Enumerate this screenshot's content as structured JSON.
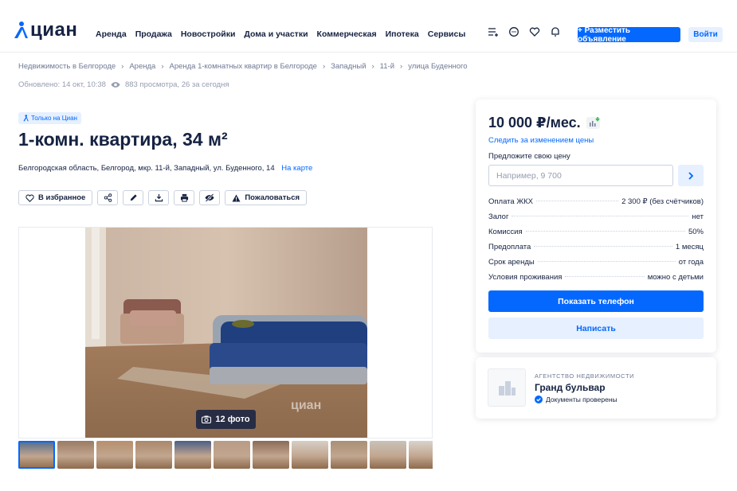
{
  "header": {
    "logo_text": "циан",
    "nav": [
      "Аренда",
      "Продажа",
      "Новостройки",
      "Дома и участки",
      "Коммерческая",
      "Ипотека",
      "Сервисы"
    ],
    "post_button": "+ Разместить объявление",
    "login_button": "Войти"
  },
  "breadcrumbs": [
    "Недвижимость в Белгороде",
    "Аренда",
    "Аренда 1-комнатных квартир в Белгороде",
    "Западный",
    "11-й",
    "улица Буденного"
  ],
  "meta": {
    "updated": "Обновлено: 14 окт, 10:38",
    "views": "883 просмотра, 26 за сегодня"
  },
  "listing": {
    "badge": "Только на Циан",
    "title": "1-комн. квартира, 34 м²",
    "address": "Белгородская область, Белгород, мкр. 11-й, Западный, ул. Буденного, 14",
    "map_link": "На карте",
    "favorite_label": "В избранное",
    "complain_label": "Пожаловаться",
    "photo_count": "12 фото",
    "photo_watermark": "циан"
  },
  "thumbs": [
    "#4f6a8a",
    "#9a7a63",
    "#b78f6e",
    "#a9876a",
    "#4c5f84",
    "#b89b86",
    "#8c6b56",
    "#d6cfc6",
    "#a88f76",
    "#c8c2b8",
    "#d9d3cc",
    "#b6875b"
  ],
  "price_card": {
    "price": "10 000 ₽/мес.",
    "follow_link": "Следить за изменением цены",
    "offer_label": "Предложите свою цену",
    "offer_placeholder": "Например, 9 700",
    "rows": [
      {
        "k": "Оплата ЖКХ",
        "v": "2 300 ₽ (без счётчиков)"
      },
      {
        "k": "Залог",
        "v": "нет"
      },
      {
        "k": "Комиссия",
        "v": "50%"
      },
      {
        "k": "Предоплата",
        "v": "1 месяц"
      },
      {
        "k": "Срок аренды",
        "v": "от года"
      },
      {
        "k": "Условия проживания",
        "v": "можно с детьми"
      }
    ],
    "phone_button": "Показать телефон",
    "write_button": "Написать"
  },
  "agency": {
    "type": "АГЕНТСТВО НЕДВИЖИМОСТИ",
    "name": "Гранд бульвар",
    "verified": "Документы проверены"
  },
  "colors": {
    "accent": "#0468ff",
    "accent_light": "#e6f0ff",
    "text": "#152242",
    "muted": "#707a95"
  }
}
